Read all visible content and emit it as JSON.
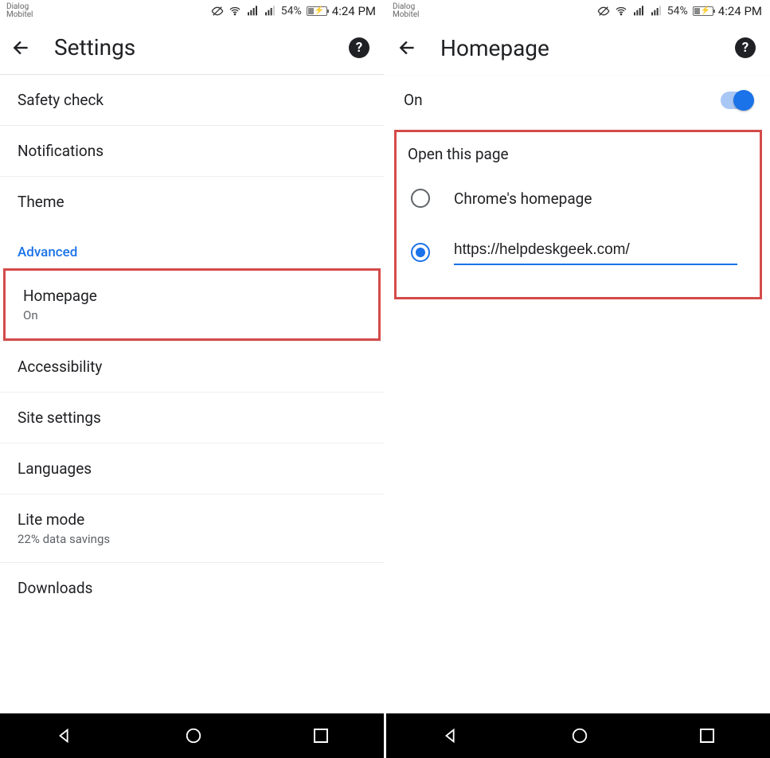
{
  "status_bar": {
    "carrier_line1": "Dialog",
    "carrier_line2": "Mobitel",
    "battery_pct": "54%",
    "time": "4:24 PM"
  },
  "left": {
    "title": "Settings",
    "items": {
      "safety_check": "Safety check",
      "notifications": "Notifications",
      "theme": "Theme",
      "advanced": "Advanced",
      "homepage": "Homepage",
      "homepage_sub": "On",
      "accessibility": "Accessibility",
      "site_settings": "Site settings",
      "languages": "Languages",
      "lite_mode": "Lite mode",
      "lite_mode_sub": "22% data savings",
      "downloads": "Downloads"
    }
  },
  "right": {
    "title": "Homepage",
    "toggle_label": "On",
    "section_label": "Open this page",
    "option_chrome": "Chrome's homepage",
    "option_custom_url": "https://helpdeskgeek.com/"
  }
}
